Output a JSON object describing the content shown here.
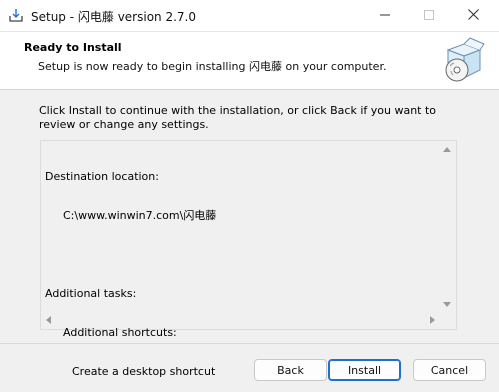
{
  "window": {
    "title": "Setup - 闪电藤 version 2.7.0",
    "icons": {
      "app": "setup-installer-icon",
      "minimize": "minimize-icon",
      "maximize": "maximize-icon",
      "close": "close-icon"
    }
  },
  "header": {
    "title": "Ready to Install",
    "subtitle": "Setup is now ready to begin installing 闪电藤 on your computer.",
    "image": "install-box-disc-icon"
  },
  "body": {
    "intro": "Click Install to continue with the installation, or click Back if you want to review or change any settings.",
    "memo": {
      "destination_label": "Destination location:",
      "destination_path": "C:\\www.winwin7.com\\闪电藤",
      "tasks_label": "Additional tasks:",
      "shortcuts_label": "Additional shortcuts:",
      "shortcut_item": "Create a desktop shortcut"
    }
  },
  "buttons": {
    "back": "Back",
    "install": "Install",
    "cancel": "Cancel"
  },
  "colors": {
    "accent": "#1f6fd1",
    "background": "#f0f0f0",
    "header_bg": "#ffffff"
  }
}
